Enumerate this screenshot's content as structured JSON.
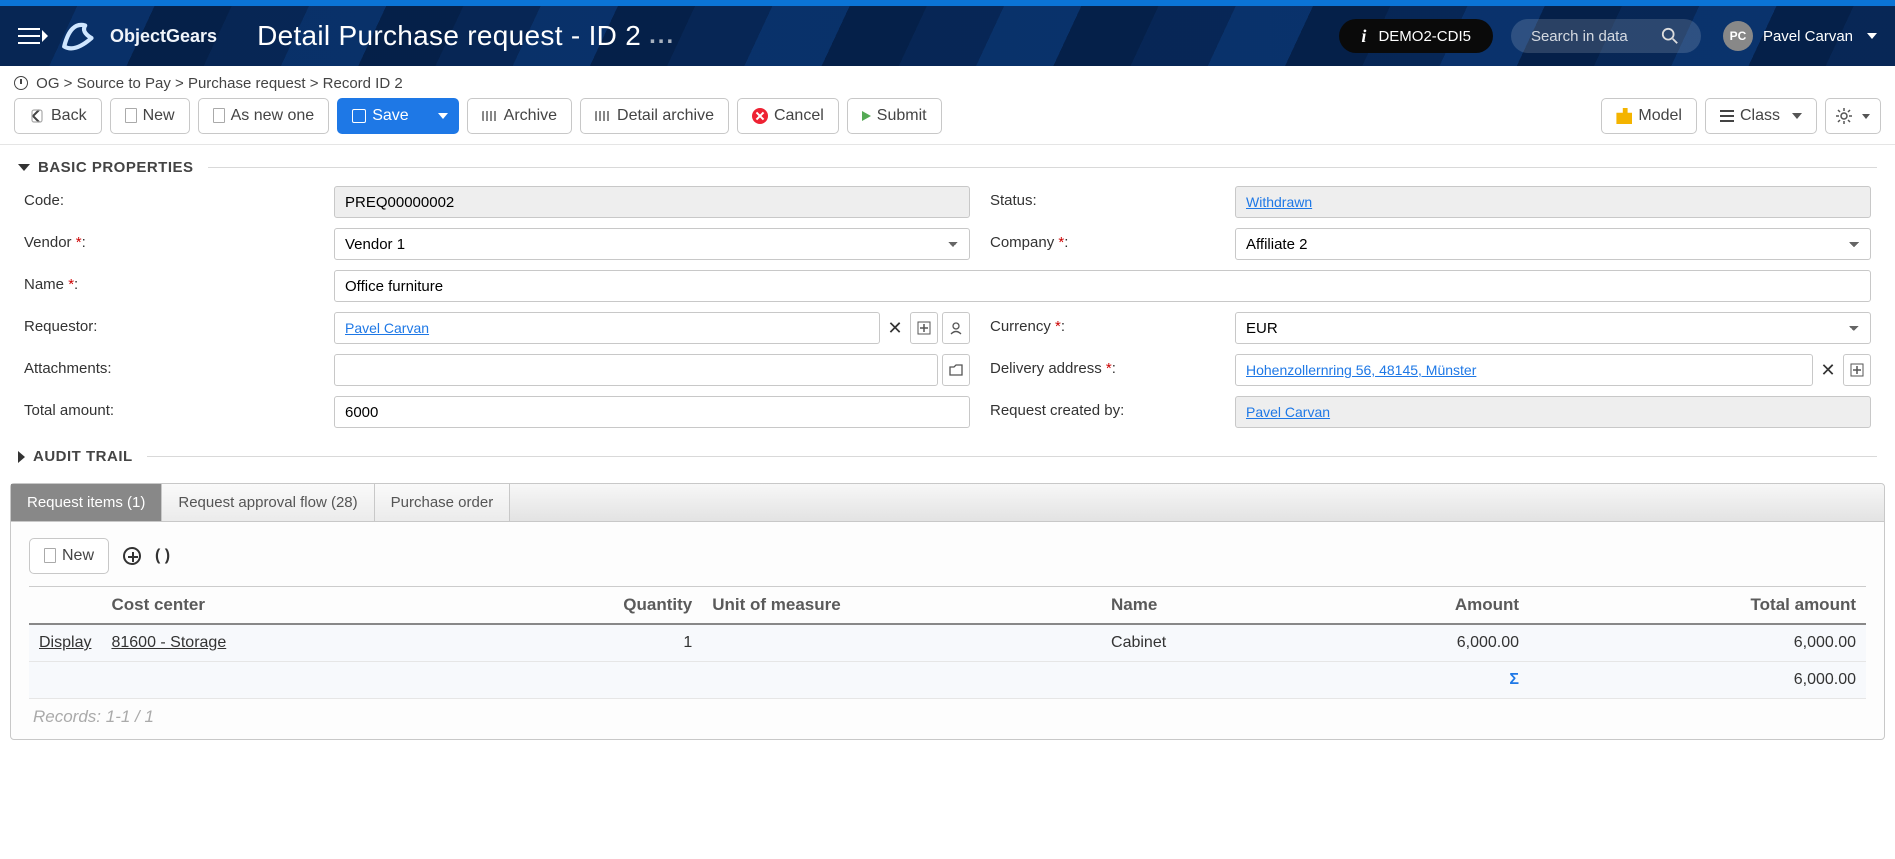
{
  "header": {
    "brand": "ObjectGears",
    "title": "Detail Purchase request - ID 2",
    "env": "DEMO2-CDI5",
    "search_placeholder": "Search in data",
    "user_initials": "PC",
    "user_name": "Pavel Carvan"
  },
  "breadcrumb": {
    "root": "OG",
    "model": "Source to Pay",
    "class": "Purchase request",
    "record": "Record ID 2"
  },
  "toolbar": {
    "back": "Back",
    "new": "New",
    "as_new": "As new one",
    "save": "Save",
    "archive": "Archive",
    "detail_archive": "Detail archive",
    "cancel": "Cancel",
    "submit": "Submit",
    "model": "Model",
    "class": "Class"
  },
  "sections": {
    "basic": "BASIC PROPERTIES",
    "audit": "AUDIT TRAIL"
  },
  "form": {
    "code_label": "Code:",
    "code_value": "PREQ00000002",
    "vendor_label": "Vendor",
    "vendor_value": "Vendor 1",
    "name_label": "Name",
    "name_value": "Office furniture",
    "requestor_label": "Requestor:",
    "requestor_value": "Pavel Carvan",
    "attachments_label": "Attachments:",
    "total_label": "Total amount:",
    "total_value": "6000",
    "status_label": "Status:",
    "status_value": "Withdrawn",
    "company_label": "Company",
    "company_value": "Affiliate 2",
    "currency_label": "Currency",
    "currency_value": "EUR",
    "delivery_label": "Delivery address",
    "delivery_value": "Hohenzollernring 56, 48145, Münster",
    "created_by_label": "Request created by:",
    "created_by_value": "Pavel Carvan"
  },
  "tabs": {
    "items": "Request items (1)",
    "approval": "Request approval flow (28)",
    "po": "Purchase order"
  },
  "subtoolbar": {
    "new": "New",
    "parens": "( )"
  },
  "table": {
    "columns": {
      "cost_center": "Cost center",
      "quantity": "Quantity",
      "uom": "Unit of measure",
      "name": "Name",
      "amount": "Amount",
      "total": "Total amount"
    },
    "rows": [
      {
        "display": "Display",
        "cost_center": "81600 - Storage",
        "quantity": "1",
        "uom": "",
        "name": "Cabinet",
        "amount": "6,000.00",
        "total": "6,000.00"
      }
    ],
    "sum_total": "6,000.00",
    "record_count": "Records: 1-1 / 1"
  }
}
